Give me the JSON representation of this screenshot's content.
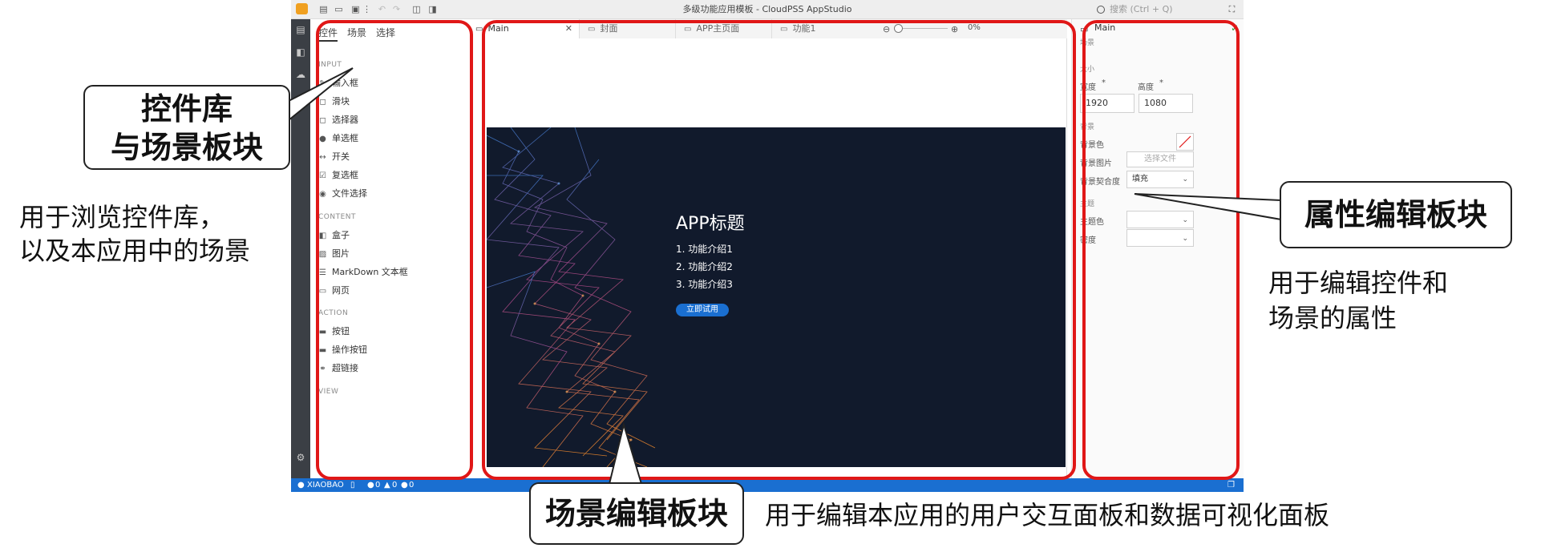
{
  "window": {
    "title": "多级功能应用模板 - CloudPSS AppStudio",
    "search_placeholder": "搜索 (Ctrl + Q)"
  },
  "left_panel": {
    "tabs": [
      "控件",
      "场景",
      "选择"
    ],
    "sections": {
      "input": {
        "title": "INPUT",
        "items": [
          {
            "label": "输入框",
            "icon": "textbox-icon"
          },
          {
            "label": "滑块",
            "icon": "slider-icon"
          },
          {
            "label": "选择器",
            "icon": "select-icon"
          },
          {
            "label": "单选框",
            "icon": "radio-icon"
          },
          {
            "label": "开关",
            "icon": "switch-icon"
          },
          {
            "label": "复选框",
            "icon": "checkbox-icon"
          },
          {
            "label": "文件选择",
            "icon": "file-icon"
          }
        ]
      },
      "content": {
        "title": "CONTENT",
        "items": [
          {
            "label": "盒子",
            "icon": "box-icon"
          },
          {
            "label": "图片",
            "icon": "image-icon"
          },
          {
            "label": "MarkDown 文本框",
            "icon": "markdown-icon"
          },
          {
            "label": "网页",
            "icon": "webpage-icon"
          }
        ]
      },
      "action": {
        "title": "ACTION",
        "items": [
          {
            "label": "按钮",
            "icon": "button-icon"
          },
          {
            "label": "操作按钮",
            "icon": "action-button-icon"
          },
          {
            "label": "超链接",
            "icon": "link-icon"
          }
        ]
      },
      "view": {
        "title": "VIEW"
      }
    }
  },
  "tabs": [
    {
      "label": "Main",
      "active": true
    },
    {
      "label": "封面",
      "active": false
    },
    {
      "label": "APP主页面",
      "active": false
    },
    {
      "label": "功能1",
      "active": false
    }
  ],
  "zoom_percent": "0%",
  "scene": {
    "title": "APP标题",
    "items": [
      "1. 功能介绍1",
      "2. 功能介绍2",
      "3. 功能介绍3"
    ],
    "button": "立即试用",
    "accent": "#1a6fd1",
    "background": "#111a2c"
  },
  "right_panel": {
    "name": "Main",
    "type": "场景",
    "size_section": "大小",
    "width_label": "宽度",
    "width_value": "1920",
    "height_label": "高度",
    "height_value": "1080",
    "required_mark": "*",
    "bg_section": "背景",
    "bg_color_label": "背景色",
    "bg_image_label": "背景图片",
    "bg_image_value": "选择文件",
    "bg_fit_label": "背景契合度",
    "bg_fit_value": "填充",
    "theme_section": "主题",
    "theme_color_label": "主题色",
    "density_label": "密度"
  },
  "status": {
    "user": "XIAOBAO",
    "errors": "0",
    "warnings": "0",
    "infos": "0"
  },
  "annotations": {
    "library_callout": [
      "控件库",
      "与场景板块"
    ],
    "library_note": [
      "用于浏览控件库，",
      "以及本应用中的场景"
    ],
    "scene_callout": "场景编辑板块",
    "scene_note": "用于编辑本应用的用户交互面板和数据可视化面板",
    "props_callout": "属性编辑板块",
    "props_note": [
      "用于编辑控件和",
      "场景的属性"
    ],
    "highlight_color": "#e01717"
  }
}
